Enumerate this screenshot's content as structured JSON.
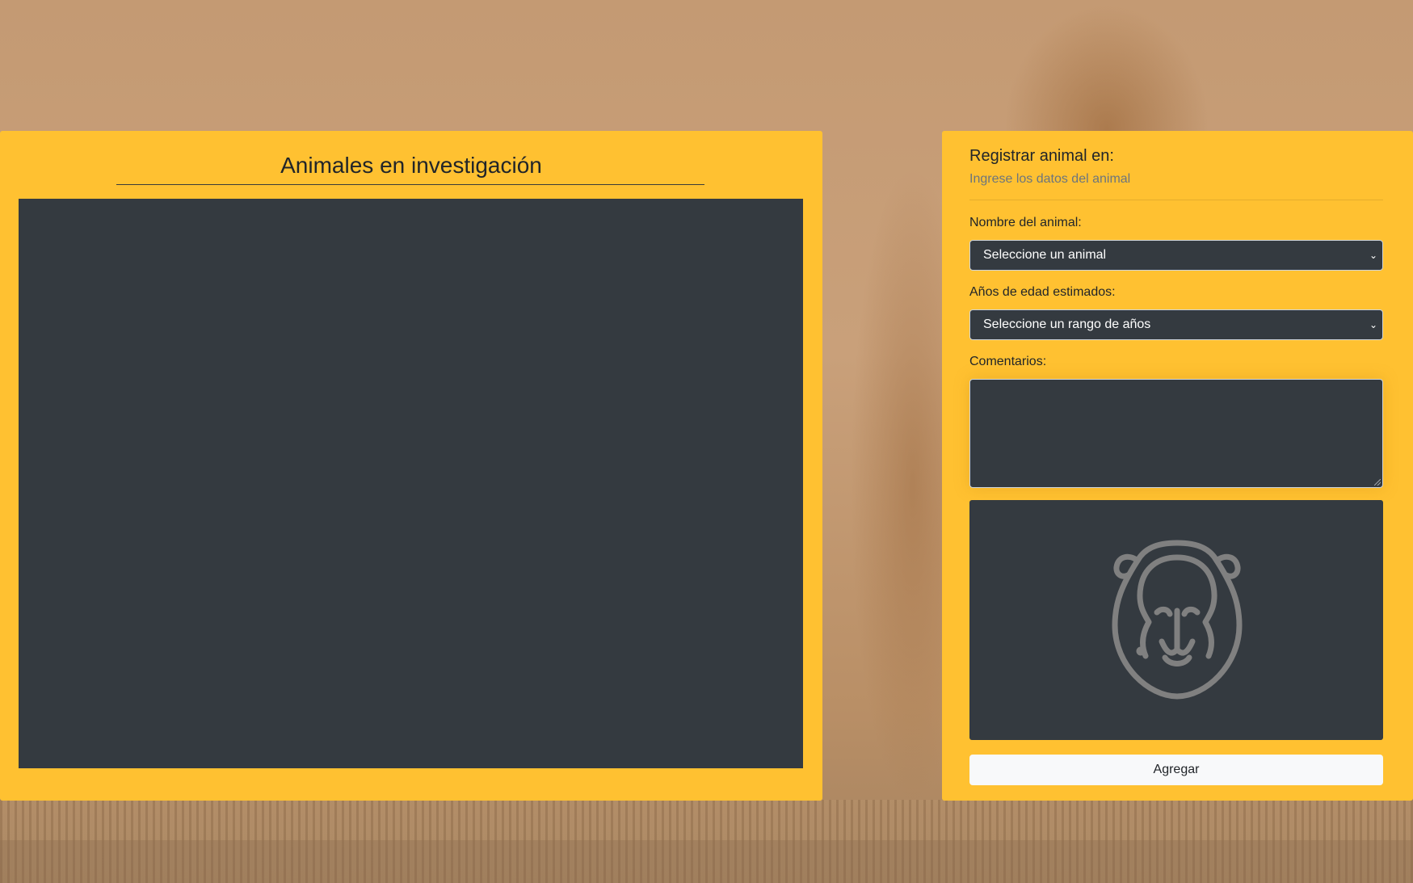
{
  "background": {
    "description_icon": "lion-photo-background"
  },
  "left_panel": {
    "title": "Animales en investigación"
  },
  "form": {
    "title": "Registrar animal en:",
    "subtitle": "Ingrese los datos del animal",
    "animal_label": "Nombre del animal:",
    "animal_select_value": "Seleccione un animal",
    "age_label": "Años de edad estimados:",
    "age_select_value": "Seleccione un rango de años",
    "comments_label": "Comentarios:",
    "comments_value": "",
    "preview_icon": "lion-icon",
    "submit_label": "Agregar"
  },
  "colors": {
    "panel": "#ffc131",
    "dark": "#343a40",
    "button": "#f8f9fa",
    "icon_stroke": "#808080"
  }
}
